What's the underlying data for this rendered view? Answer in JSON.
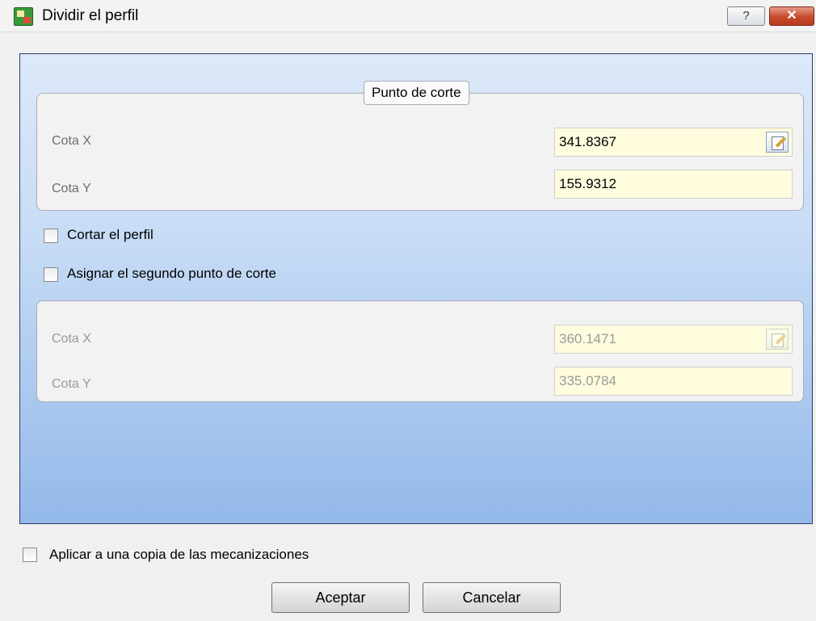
{
  "window": {
    "title": "Dividir el perfil",
    "help_label": "?",
    "close_label": "✕"
  },
  "group_cut_point": {
    "title": "Punto de corte",
    "x_label": "Cota X",
    "x_value": "341.8367",
    "y_label": "Cota Y",
    "y_value": "155.9312"
  },
  "options": {
    "cut_profile_label": "Cortar el perfil",
    "second_point_label": "Asignar el segundo punto de corte"
  },
  "group_second_point": {
    "x_label": "Cota X",
    "x_value": "360.1471",
    "y_label": "Cota Y",
    "y_value": "335.0784"
  },
  "footer": {
    "apply_copy_label": "Aplicar a una copia de las mecanizaciones",
    "ok_label": "Aceptar",
    "cancel_label": "Cancelar"
  }
}
